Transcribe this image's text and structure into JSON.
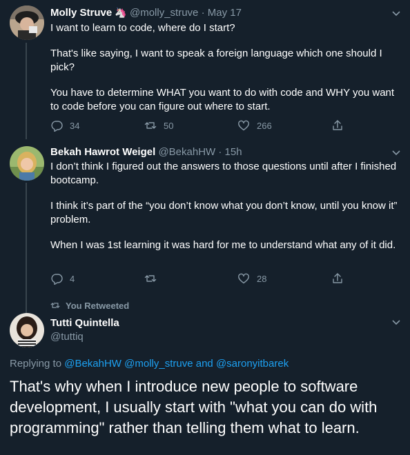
{
  "tweets": [
    {
      "name": "Molly Struve",
      "badge": "🦄",
      "handle": "@molly_struve",
      "date": "May 17",
      "paragraphs": [
        "I want to learn to code, where do I start?",
        "That's like saying, I want to speak a foreign language which one should I pick?",
        "You have to determine WHAT you want to do with code and WHY you want to code before you can figure out where to start."
      ],
      "replies": "34",
      "retweets": "50",
      "likes": "266"
    },
    {
      "name": "Bekah Hawrot Weigel",
      "handle": "@BekahHW",
      "date": "15h",
      "paragraphs": [
        "I don’t think I figured out the answers to those questions until after I finished bootcamp.",
        "I think it’s part of the “you don’t know what you don’t know, until you know it” problem.",
        "When I was 1st learning it was hard for me to understand what any of it did."
      ],
      "replies": "4",
      "retweets": "",
      "likes": "28"
    }
  ],
  "retweeted_label": "You Retweeted",
  "main_tweet": {
    "name": "Tutti Quintella",
    "handle": "@tuttiq",
    "replying_prefix": "Replying to",
    "replying_1": "@BekahHW",
    "replying_2": "@molly_struve",
    "replying_and": "and",
    "replying_3": "@saronyitbarek",
    "text": "That's why when I introduce new people to software development, I usually start with \"what you can do with programming\" rather than telling them what to learn."
  },
  "colors": {
    "background": "#15202b",
    "secondary_text": "#8899a6",
    "link": "#1da1f2",
    "thread_line": "#38444d"
  }
}
